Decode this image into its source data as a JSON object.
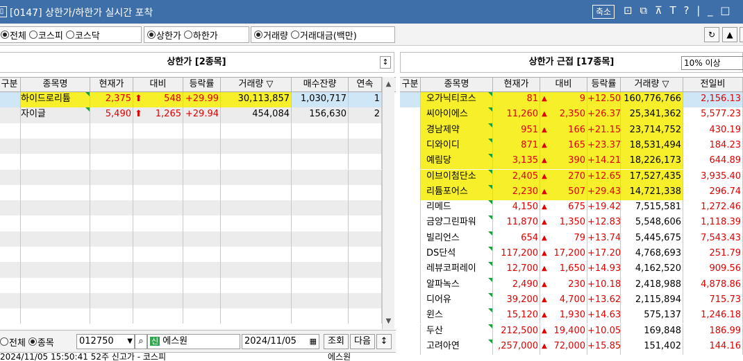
{
  "window": {
    "title": "[0147] 상한가/하한가 실시간 포착",
    "shrink_label": "축소",
    "icon_glyphs": "⊡ ⧉ ⊼ T ? | _ □"
  },
  "toolbar": {
    "market_options": [
      {
        "label": "전체",
        "selected": true
      },
      {
        "label": "코스피",
        "selected": false
      },
      {
        "label": "코스닥",
        "selected": false
      }
    ],
    "limit_options": [
      {
        "label": "상한가",
        "selected": true
      },
      {
        "label": "하한가",
        "selected": false
      }
    ],
    "sort_options": [
      {
        "label": "거래량",
        "selected": true
      },
      {
        "label": "거래대금(백만)",
        "selected": false
      }
    ],
    "refresh_icon": "refresh-icon",
    "up_icon": "triangle-up-icon"
  },
  "left_panel": {
    "title": "상한가 [2종목]",
    "columns": [
      "구분",
      "종목명",
      "현재가",
      "대비",
      "등락률",
      "거래량 ▽",
      "매수잔량",
      "연속"
    ],
    "rows": [
      {
        "name": "하이드로리튬",
        "price": "2,375",
        "change": "548",
        "rate": "+29.99",
        "volume": "30,113,857",
        "bid": "1,030,717",
        "streak": "1",
        "highlight": true
      },
      {
        "name": "자이글",
        "price": "5,490",
        "change": "1,265",
        "rate": "+29.94",
        "volume": "454,084",
        "bid": "156,630",
        "streak": "2",
        "highlight": false
      }
    ],
    "empty_rows": 13
  },
  "right_panel": {
    "title": "상한가 근접 [17종목]",
    "filter_value": "10% 이상",
    "columns": [
      "구분",
      "종목명",
      "현재가",
      "대비",
      "등락률",
      "거래량 ▽",
      "전일비"
    ],
    "rows": [
      {
        "name": "오가닉티코스",
        "price": "81",
        "change": "9",
        "rate": "+12.50",
        "volume": "160,776,766",
        "prev": "2,156.13",
        "hl": true
      },
      {
        "name": "씨아이에스",
        "price": "11,260",
        "change": "2,350",
        "rate": "+26.37",
        "volume": "25,341,362",
        "prev": "5,577.23",
        "hl": true
      },
      {
        "name": "경남제약",
        "price": "951",
        "change": "166",
        "rate": "+21.15",
        "volume": "23,714,752",
        "prev": "430.19",
        "hl": true
      },
      {
        "name": "디와이디",
        "price": "871",
        "change": "165",
        "rate": "+23.37",
        "volume": "18,531,494",
        "prev": "184.23",
        "hl": true
      },
      {
        "name": "예림당",
        "price": "3,135",
        "change": "390",
        "rate": "+14.21",
        "volume": "18,226,173",
        "prev": "644.89",
        "hl": true
      },
      {
        "name": "이브이첨단소",
        "price": "2,405",
        "change": "270",
        "rate": "+12.65",
        "volume": "17,527,435",
        "prev": "3,935.40",
        "hl": true
      },
      {
        "name": "리튬포어스",
        "price": "2,230",
        "change": "507",
        "rate": "+29.43",
        "volume": "14,721,338",
        "prev": "296.74",
        "hl": true
      },
      {
        "name": "리메드",
        "price": "4,150",
        "change": "675",
        "rate": "+19.42",
        "volume": "7,515,581",
        "prev": "1,272.46",
        "hl": false
      },
      {
        "name": "금양그린파워",
        "price": "11,870",
        "change": "1,350",
        "rate": "+12.83",
        "volume": "5,548,606",
        "prev": "1,118.39",
        "hl": false
      },
      {
        "name": "빌리언스",
        "price": "654",
        "change": "79",
        "rate": "+13.74",
        "volume": "5,445,675",
        "prev": "7,543.43",
        "hl": false
      },
      {
        "name": "DS단석",
        "price": "117,200",
        "change": "17,200",
        "rate": "+17.20",
        "volume": "4,768,693",
        "prev": "251.79",
        "hl": false
      },
      {
        "name": "레뷰코퍼레이",
        "price": "12,700",
        "change": "1,650",
        "rate": "+14.93",
        "volume": "4,162,520",
        "prev": "909.56",
        "hl": false
      },
      {
        "name": "알파녹스",
        "price": "2,490",
        "change": "230",
        "rate": "+10.18",
        "volume": "2,418,988",
        "prev": "4,878.86",
        "hl": false
      },
      {
        "name": "디어유",
        "price": "39,200",
        "change": "4,700",
        "rate": "+13.62",
        "volume": "2,115,894",
        "prev": "715.73",
        "hl": false
      },
      {
        "name": "윈스",
        "price": "15,120",
        "change": "1,930",
        "rate": "+14.63",
        "volume": "575,137",
        "prev": "1,246.18",
        "hl": false
      },
      {
        "name": "두산",
        "price": "212,500",
        "change": "19,400",
        "rate": "+10.05",
        "volume": "169,848",
        "prev": "186.99",
        "hl": false
      },
      {
        "name": "고려아연",
        "price": ",257,000",
        "change": "72,000",
        "rate": "+15.85",
        "volume": "151,402",
        "prev": "144.16",
        "hl": false
      }
    ]
  },
  "bottom_bar": {
    "scope_options": [
      {
        "label": "전체",
        "selected": false
      },
      {
        "label": "종목",
        "selected": true
      }
    ],
    "code_value": "012750",
    "badge": "신",
    "stock_name": "에스원",
    "date_value": "2024/11/05",
    "query_label": "조회",
    "next_label": "다음"
  },
  "log": {
    "line": "2024/11/05   15:50:41  52주 신고가 - 코스피",
    "stock": "에스원"
  },
  "colors": {
    "titlebar": "#3e6fa8",
    "highlight": "#f6ef2a",
    "up_red": "#e00000",
    "corner_green": "#1aa03c"
  }
}
